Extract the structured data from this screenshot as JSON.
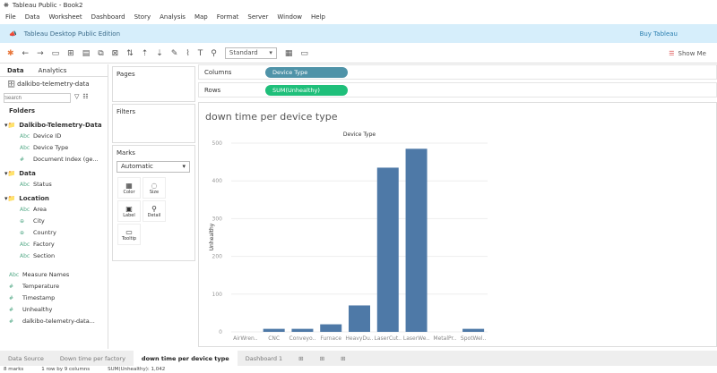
{
  "window": {
    "title": "Tableau Public - Book2"
  },
  "menu": [
    "File",
    "Data",
    "Worksheet",
    "Dashboard",
    "Story",
    "Analysis",
    "Map",
    "Format",
    "Server",
    "Window",
    "Help"
  ],
  "banner": {
    "edition": "Tableau Desktop Public Edition",
    "buy": "Buy Tableau"
  },
  "toolbar": {
    "fit": "Standard",
    "show_me": "Show Me"
  },
  "left": {
    "tabs": [
      "Data",
      "Analytics"
    ],
    "source": "dalkibo-telemetry-data",
    "search_placeholder": "Search",
    "folders_label": "Folders",
    "groups": [
      {
        "name": "Dalkibo-Telemetry-Data",
        "fields": [
          {
            "t": "Abc",
            "n": "Device ID"
          },
          {
            "t": "Abc",
            "n": "Device Type"
          },
          {
            "t": "#",
            "n": "Document Index (ge..."
          }
        ]
      },
      {
        "name": "Data",
        "fields": [
          {
            "t": "Abc",
            "n": "Status"
          }
        ]
      },
      {
        "name": "Location",
        "fields": [
          {
            "t": "Abc",
            "n": "Area"
          },
          {
            "t": "⊕",
            "n": "City"
          },
          {
            "t": "⊕",
            "n": "Country"
          },
          {
            "t": "Abc",
            "n": "Factory"
          },
          {
            "t": "Abc",
            "n": "Section"
          }
        ]
      }
    ],
    "measures": [
      {
        "t": "Abc",
        "n": "Measure Names"
      },
      {
        "t": "#",
        "n": "Temperature"
      },
      {
        "t": "#",
        "n": "Timestamp"
      },
      {
        "t": "#",
        "n": "Unhealthy"
      },
      {
        "t": "#",
        "n": "dalkibo-telemetry-data..."
      }
    ]
  },
  "cards": {
    "pages": "Pages",
    "filters": "Filters",
    "marks": "Marks",
    "mark_type": "Automatic",
    "buttons": [
      "Color",
      "Size",
      "Label",
      "Detail",
      "Tooltip"
    ]
  },
  "shelves": {
    "columns_label": "Columns",
    "columns_pill": "Device Type",
    "rows_label": "Rows",
    "rows_pill": "SUM(Unhealthy)",
    "columns_color": "#4f93a8",
    "rows_color": "#1fbf7a"
  },
  "chart_data": {
    "type": "bar",
    "title": "down time per device type",
    "header": "Device Type",
    "ylabel": "Unhealthy",
    "ylim": [
      0,
      500
    ],
    "yticks": [
      0,
      100,
      200,
      300,
      400,
      500
    ],
    "categories": [
      "AirWren..",
      "CNC",
      "Conveyo..",
      "Furnace",
      "HeavyDu..",
      "LaserCut..",
      "LaserWe..",
      "MetalPr..",
      "SpotWel.."
    ],
    "values": [
      0,
      8,
      8,
      20,
      70,
      435,
      485,
      0,
      8
    ],
    "color": "#4e79a7"
  },
  "tabs": [
    "Data Source",
    "Down time per factory",
    "down time per device type",
    "Dashboard 1"
  ],
  "status": [
    "8 marks",
    "1 row by 9 columns",
    "SUM(Unhealthy): 1,042"
  ]
}
